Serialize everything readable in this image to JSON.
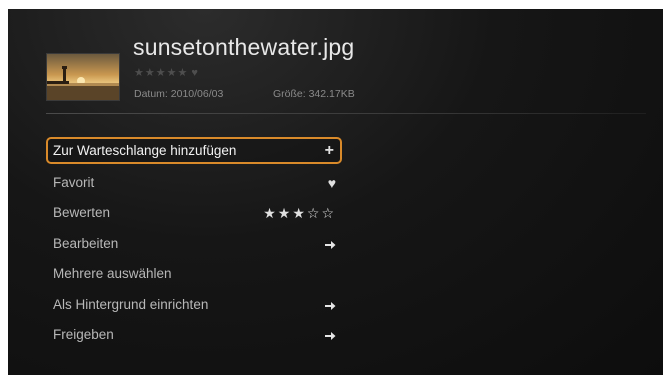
{
  "file": {
    "title": "sunsetonthewater.jpg",
    "rating_stars": "★★★★★",
    "date_label": "Datum: 2010/06/03",
    "size_label": "Größe: 342.17KB"
  },
  "menu": {
    "items": [
      {
        "label": "Zur Warteschlange hinzufügen",
        "action_icon": "plus-icon",
        "glyph": "+"
      },
      {
        "label": "Favorit",
        "action_icon": "heart-icon",
        "glyph": "♥"
      },
      {
        "label": "Bewerten",
        "action_icon": "stars",
        "glyph": "★★★☆☆",
        "rating": 3
      },
      {
        "label": "Bearbeiten",
        "action_icon": "arrow-right-icon"
      },
      {
        "label": "Mehrere auswählen"
      },
      {
        "label": "Als Hintergrund einrichten",
        "action_icon": "arrow-right-icon"
      },
      {
        "label": "Freigeben",
        "action_icon": "arrow-right-icon"
      }
    ],
    "selected_index": 0
  },
  "colors": {
    "highlight": "#d98a2a",
    "background": "#141414"
  }
}
